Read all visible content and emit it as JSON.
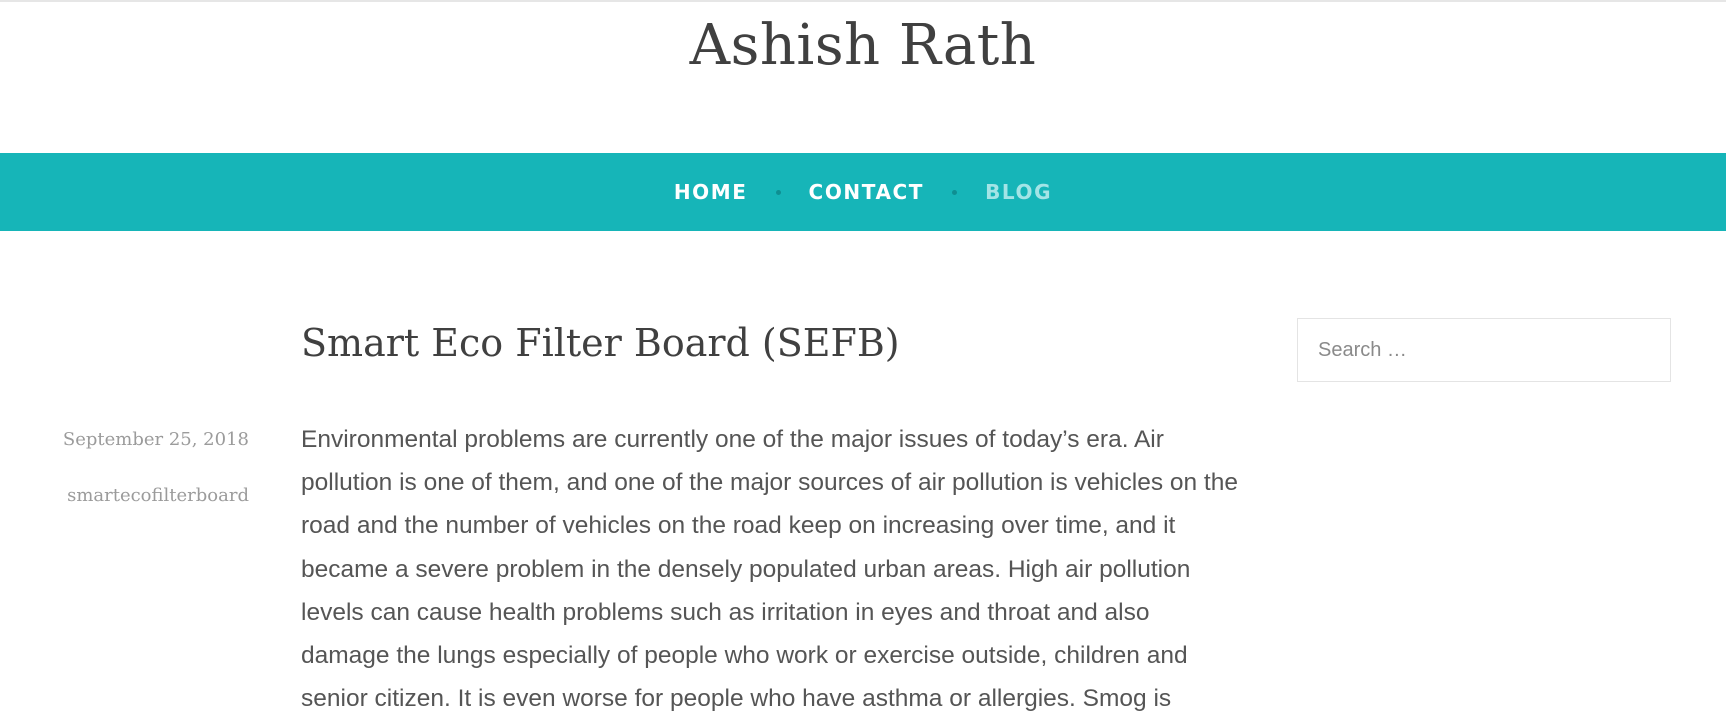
{
  "site": {
    "title": "Ashish Rath"
  },
  "nav": {
    "items": [
      {
        "label": "HOME"
      },
      {
        "label": "CONTACT"
      },
      {
        "label": "BLOG",
        "active": true
      }
    ]
  },
  "post": {
    "title": "Smart Eco Filter Board (SEFB)",
    "date": "September 25, 2018",
    "author": "smartecofilterboard",
    "body": "Environmental problems are currently one of the major issues of today’s era. Air pollution is one of them, and one of the major sources of air pollution is vehicles on the road and the number of vehicles on the road keep on increasing over time, and it became a severe problem in the densely populated urban areas. High air pollution levels can cause health problems such as irritation in eyes and throat and also damage the lungs especially of people who work or exercise outside, children and senior citizen. It is even worse for people who have asthma or allergies. Smog is"
  },
  "sidebar": {
    "search": {
      "placeholder": "Search …"
    }
  },
  "colors": {
    "nav_background": "#16b5b8",
    "nav_text": "#ffffff",
    "nav_active_text": "#a3e4e6",
    "nav_separator": "#0e8f92"
  }
}
